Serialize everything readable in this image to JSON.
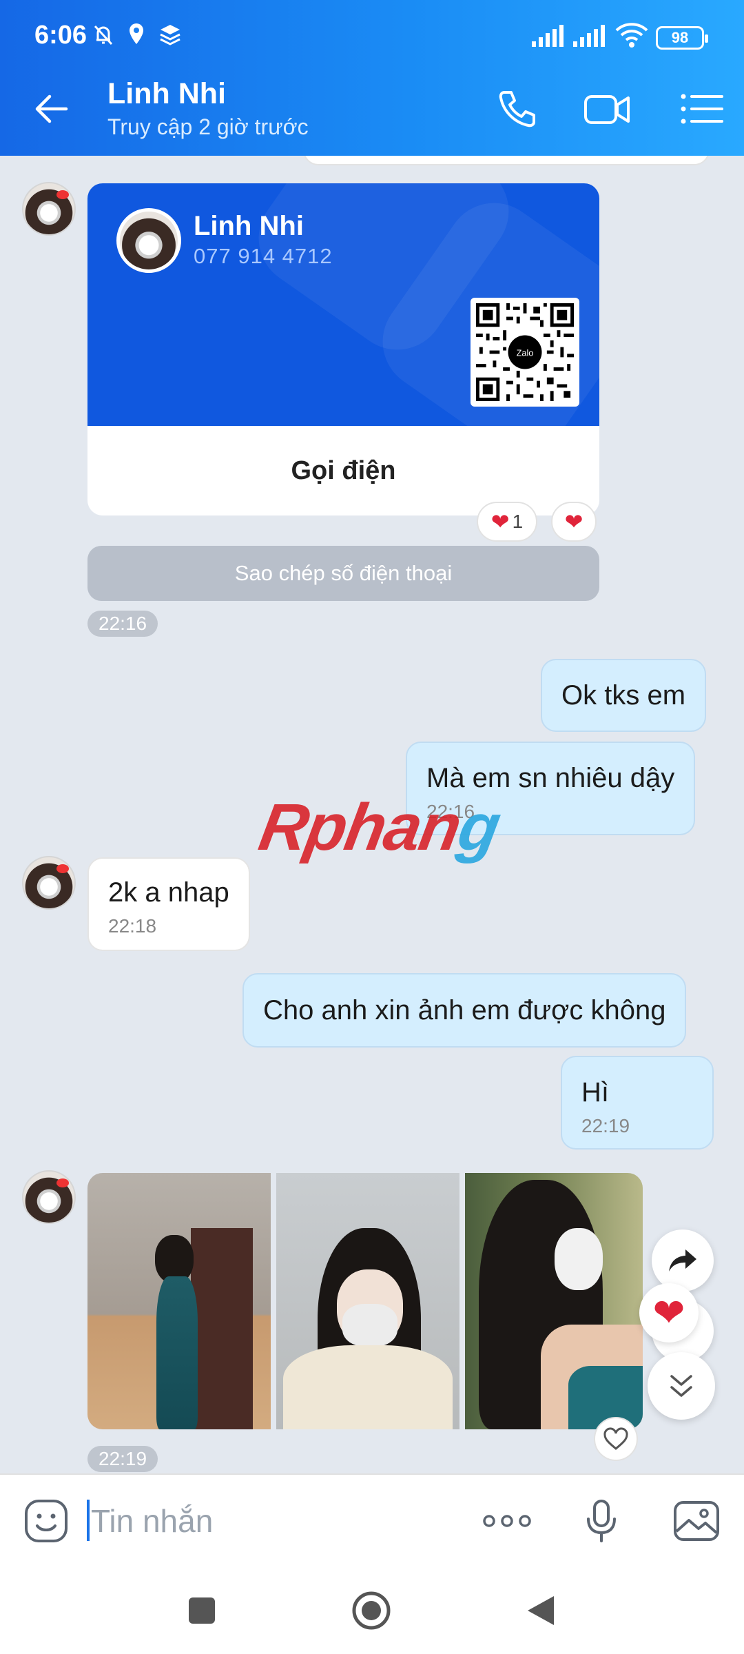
{
  "status_bar": {
    "time": "6:06",
    "battery": "98"
  },
  "header": {
    "contact_name": "Linh Nhi",
    "last_seen": "Truy cập 2 giờ trước"
  },
  "contact_card": {
    "name": "Linh Nhi",
    "phone": "077 914 4712",
    "qr_logo": "Zalo",
    "call_label": "Gọi điện",
    "reaction_count": "1",
    "copy_phone_label": "Sao chép số điện thoại",
    "time": "22:16"
  },
  "messages": [
    {
      "text": "Ok tks em",
      "time": ""
    },
    {
      "text": "Mà em sn nhiêu dậy",
      "time": "22:16"
    },
    {
      "text": "2k a nhap",
      "time": "22:18"
    },
    {
      "text": "Cho anh xin ảnh em được không",
      "time": ""
    },
    {
      "text": "Hì",
      "time": "22:19"
    }
  ],
  "photos": {
    "time": "22:19"
  },
  "watermark": {
    "part1": "Rphan",
    "part2": "g"
  },
  "input": {
    "placeholder": "Tin nhắn"
  },
  "icons": {
    "status": [
      "bell-off-icon",
      "location-icon",
      "layers-icon",
      "signal-icon",
      "wifi-icon",
      "battery-icon"
    ],
    "header": [
      "back-arrow-icon",
      "phone-icon",
      "video-call-icon",
      "menu-list-icon"
    ],
    "input": [
      "sticker-icon",
      "more-icon",
      "microphone-icon",
      "image-icon"
    ],
    "nav": [
      "recents-icon",
      "home-icon",
      "back-icon"
    ]
  },
  "colors": {
    "header_start": "#1568e6",
    "header_end": "#29a9ff",
    "outgoing_bubble": "#d4eefe",
    "card_blue": "#1058df",
    "heart": "#e0243a"
  }
}
